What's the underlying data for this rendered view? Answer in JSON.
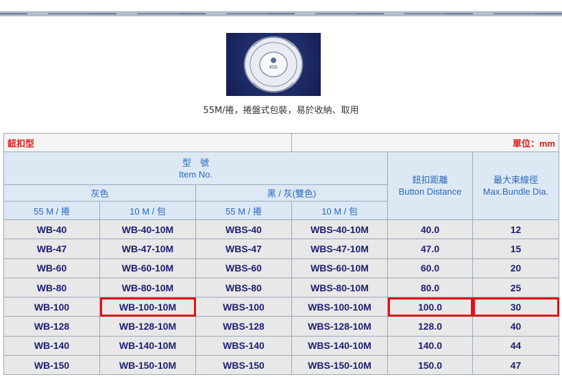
{
  "caption": "55M/捲，捲盤式包裝，易於收納、取用",
  "product_photo": {
    "ring_text": "WEB WRAPPING BAND",
    "brand_text": "KSS"
  },
  "table": {
    "title": "鈕扣型",
    "unit": "單位：mm",
    "model_header_cn": "型　號",
    "model_header_en": "Item No.",
    "group_gray": "灰色",
    "group_black_gray": "黑 / 灰(雙色)",
    "pack_55m": "55 M / 捲",
    "pack_10m": "10 M / 包",
    "button_distance_cn": "鈕扣距離",
    "button_distance_en": "Button Distance",
    "max_bundle_cn": "最大束線徑",
    "max_bundle_en": "Max.Bundle Dia.",
    "rows": [
      [
        "WB-40",
        "WB-40-10M",
        "WBS-40",
        "WBS-40-10M",
        "40.0",
        "12"
      ],
      [
        "WB-47",
        "WB-47-10M",
        "WBS-47",
        "WBS-47-10M",
        "47.0",
        "15"
      ],
      [
        "WB-60",
        "WB-60-10M",
        "WBS-60",
        "WBS-60-10M",
        "60.0",
        "20"
      ],
      [
        "WB-80",
        "WB-80-10M",
        "WBS-80",
        "WBS-80-10M",
        "80.0",
        "25"
      ],
      [
        "WB-100",
        "WB-100-10M",
        "WBS-100",
        "WBS-100-10M",
        "100.0",
        "30"
      ],
      [
        "WB-128",
        "WB-128-10M",
        "WBS-128",
        "WBS-128-10M",
        "128.0",
        "40"
      ],
      [
        "WB-140",
        "WB-140-10M",
        "WBS-140",
        "WBS-140-10M",
        "140.0",
        "44"
      ],
      [
        "WB-150",
        "WB-150-10M",
        "WBS-150",
        "WBS-150-10M",
        "150.0",
        "47"
      ]
    ],
    "highlighted_row_index": 4,
    "highlight_color": "#e01010"
  }
}
